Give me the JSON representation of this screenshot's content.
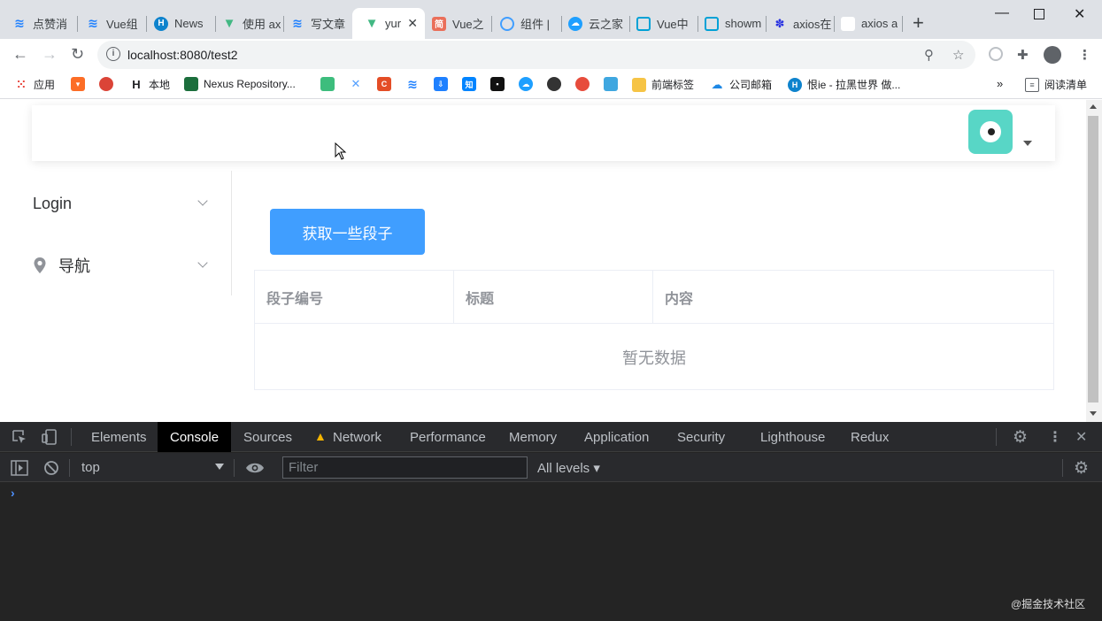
{
  "browser": {
    "tabs": [
      {
        "label": "点赞消",
        "favicon": "juejin-icon",
        "color": "#1e80ff"
      },
      {
        "label": "Vue组",
        "favicon": "juejin-icon",
        "color": "#1e80ff"
      },
      {
        "label": "News",
        "favicon": "hexo-icon",
        "color": "#0e83cd"
      },
      {
        "label": "使用 ax",
        "favicon": "vue-icon",
        "color": "#42b883"
      },
      {
        "label": "写文章",
        "favicon": "juejin-icon",
        "color": "#1e80ff"
      },
      {
        "label": "yur",
        "favicon": "vue-icon",
        "color": "#42b883",
        "active": true
      },
      {
        "label": "Vue之",
        "favicon": "jianshu-icon",
        "color": "#ea6f5a"
      },
      {
        "label": "组件 | ",
        "favicon": "element-icon",
        "color": "#409eff"
      },
      {
        "label": "云之家",
        "favicon": "cloud-icon",
        "color": "#1e9fff"
      },
      {
        "label": "Vue中",
        "favicon": "bilibili-icon",
        "color": "#00a1d6"
      },
      {
        "label": "showm",
        "favicon": "bilibili-icon",
        "color": "#00a1d6"
      },
      {
        "label": "axios在",
        "favicon": "baidu-icon",
        "color": "#2932e1"
      },
      {
        "label": "axios a",
        "favicon": "blank-page-icon",
        "color": "#ffffff"
      }
    ],
    "url": "localhost:8080/test2",
    "bookmarks": {
      "apps": "应用",
      "local": "本地",
      "nexus": "Nexus Repository...",
      "frontend": "前端标签",
      "mail": "公司邮箱",
      "hateie": "恨ie - 拉黑世界 做...",
      "reading_list": "阅读清单"
    }
  },
  "page": {
    "menu": {
      "login": "Login",
      "nav": "导航"
    },
    "fetch_button": "获取一些段子",
    "table": {
      "columns": [
        "段子编号",
        "标题",
        "内容"
      ],
      "empty_text": "暂无数据"
    }
  },
  "devtools": {
    "tabs": [
      "Elements",
      "Console",
      "Sources",
      "Network",
      "Performance",
      "Memory",
      "Application",
      "Security",
      "Lighthouse",
      "Redux"
    ],
    "active_tab": "Console",
    "context": "top",
    "filter_placeholder": "Filter",
    "levels": "All levels",
    "prompt": "›",
    "watermark": "@掘金技术社区"
  },
  "colors": {
    "primary": "#409eff",
    "avatar_bg": "#58d6c6",
    "devtools_bg": "#242424"
  }
}
